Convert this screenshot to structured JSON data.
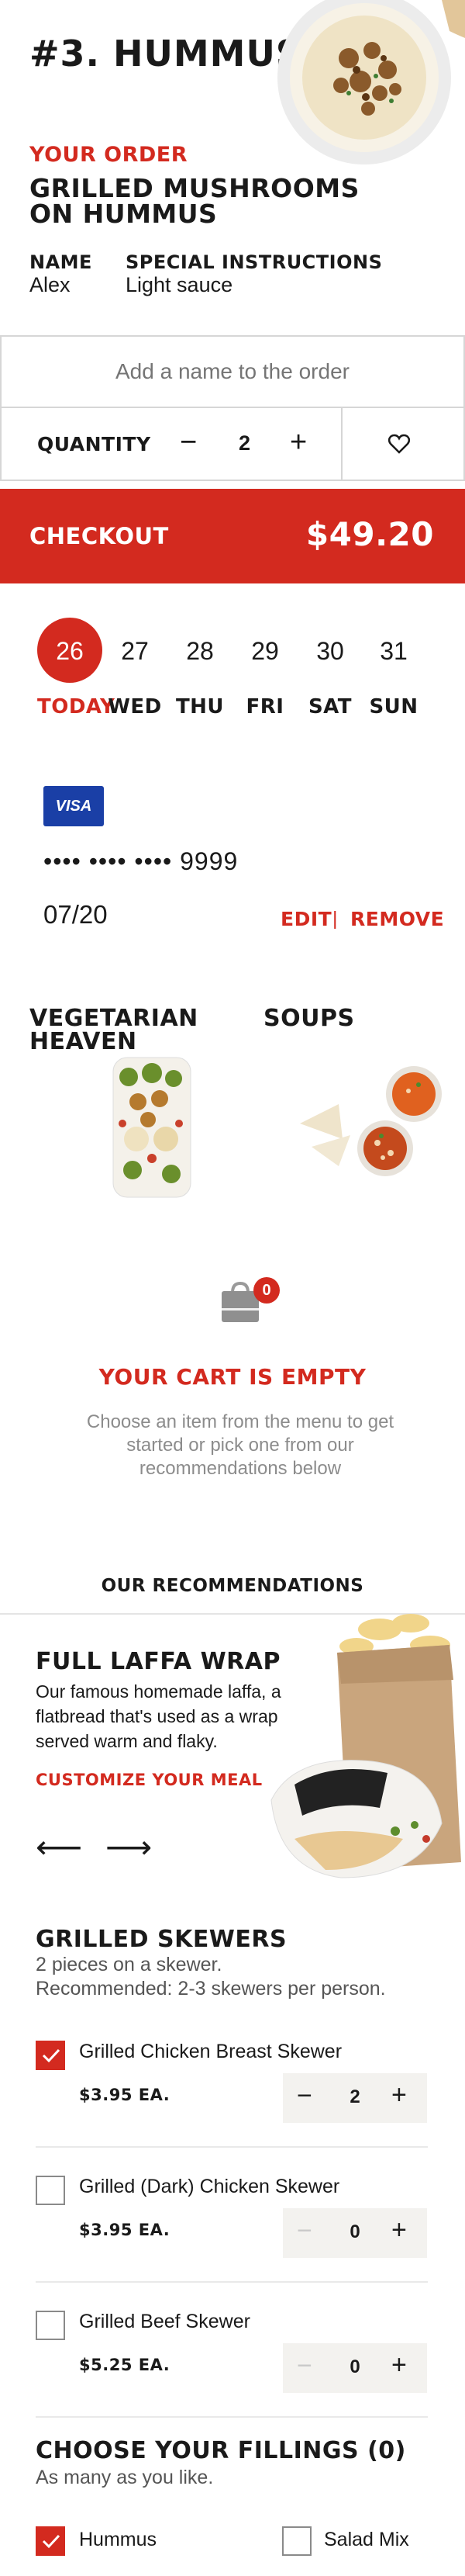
{
  "product": {
    "title": "#3. HUMMUS",
    "order_label": "YOUR ORDER",
    "order_name_line1": "GRILLED MUSHROOMS",
    "order_name_line2": "ON HUMMUS",
    "name_header": "NAME",
    "name_value": "Alex",
    "instructions_header": "SPECIAL INSTRUCTIONS",
    "instructions_value": "Light sauce"
  },
  "order_form": {
    "name_placeholder": "Add a name to the order",
    "quantity_label": "QUANTITY",
    "quantity": "2",
    "minus_glyph": "−",
    "plus_glyph": "+"
  },
  "checkout": {
    "label": "CHECKOUT",
    "price": "$49.20"
  },
  "dates": [
    {
      "num": "26",
      "day": "TODAY",
      "selected": true
    },
    {
      "num": "27",
      "day": "WED"
    },
    {
      "num": "28",
      "day": "THU"
    },
    {
      "num": "29",
      "day": "FRI"
    },
    {
      "num": "30",
      "day": "SAT"
    },
    {
      "num": "31",
      "day": "SUN"
    }
  ],
  "payment": {
    "brand": "VISA",
    "number": "•••• •••• •••• 9999",
    "expiry": "07/20",
    "edit": "EDIT",
    "separator": "|",
    "remove": "REMOVE"
  },
  "categories": [
    {
      "line1": "VEGETARIAN",
      "line2": "HEAVEN"
    },
    {
      "line1": "SOUPS",
      "line2": ""
    }
  ],
  "cart": {
    "count": "0",
    "empty_title": "YOUR CART IS EMPTY",
    "empty_text": "Choose an item from the menu to get started or pick one from our recommendations below"
  },
  "recommendations": {
    "heading": "OUR RECOMMENDATIONS",
    "item_title": "FULL LAFFA WRAP",
    "item_desc": "Our famous homemade laffa, a flatbread that's used as a wrap served warm and flaky.",
    "cta": "CUSTOMIZE YOUR MEAL",
    "prev": "⟵",
    "next": "⟶"
  },
  "skewers": {
    "title": "GRILLED SKEWERS",
    "subtitle_line1": "2 pieces on a skewer.",
    "subtitle_line2": "Recommended: 2-3 skewers per person.",
    "items": [
      {
        "name": "Grilled Chicken Breast Skewer",
        "price": "$3.95 EA.",
        "qty": "2",
        "checked": true
      },
      {
        "name": "Grilled (Dark) Chicken Skewer",
        "price": "$3.95 EA.",
        "qty": "0",
        "checked": false
      },
      {
        "name": "Grilled Beef Skewer",
        "price": "$5.25 EA.",
        "qty": "0",
        "checked": false
      }
    ]
  },
  "fillings": {
    "title": "CHOOSE YOUR FILLINGS (0)",
    "subtitle": "As many as you like.",
    "items": [
      {
        "name": "Hummus",
        "checked": true
      },
      {
        "name": "Salad Mix",
        "checked": false
      }
    ]
  },
  "colors": {
    "accent": "#d32a1f",
    "visa": "#1a3fa6",
    "stepper_bg": "#f3f2ef"
  }
}
